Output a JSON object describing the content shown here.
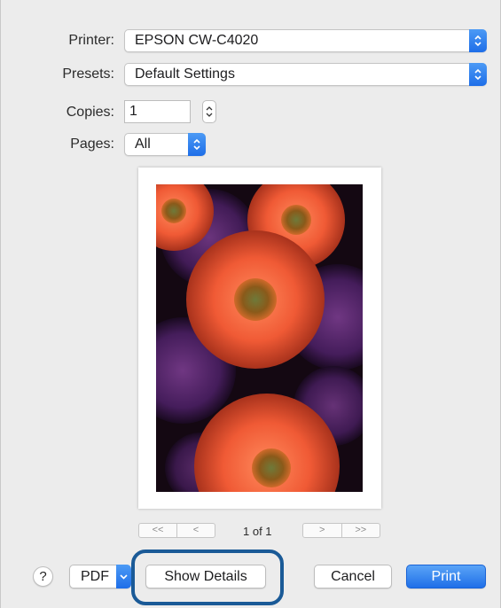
{
  "printer": {
    "label": "Printer:",
    "value": "EPSON CW-C4020"
  },
  "presets": {
    "label": "Presets:",
    "value": "Default Settings"
  },
  "copies": {
    "label": "Copies:",
    "value": "1"
  },
  "pages": {
    "label": "Pages:",
    "value": "All"
  },
  "preview": {
    "page_indicator": "1 of 1",
    "first": "<<",
    "prev": "<",
    "next": ">",
    "last": ">>"
  },
  "footer": {
    "help": "?",
    "pdf": "PDF",
    "show_details": "Show Details",
    "cancel": "Cancel",
    "print": "Print"
  },
  "colors": {
    "accent": "#1f6fe8",
    "highlight_ring": "#1a5a97",
    "dialog_bg": "#ececec"
  }
}
